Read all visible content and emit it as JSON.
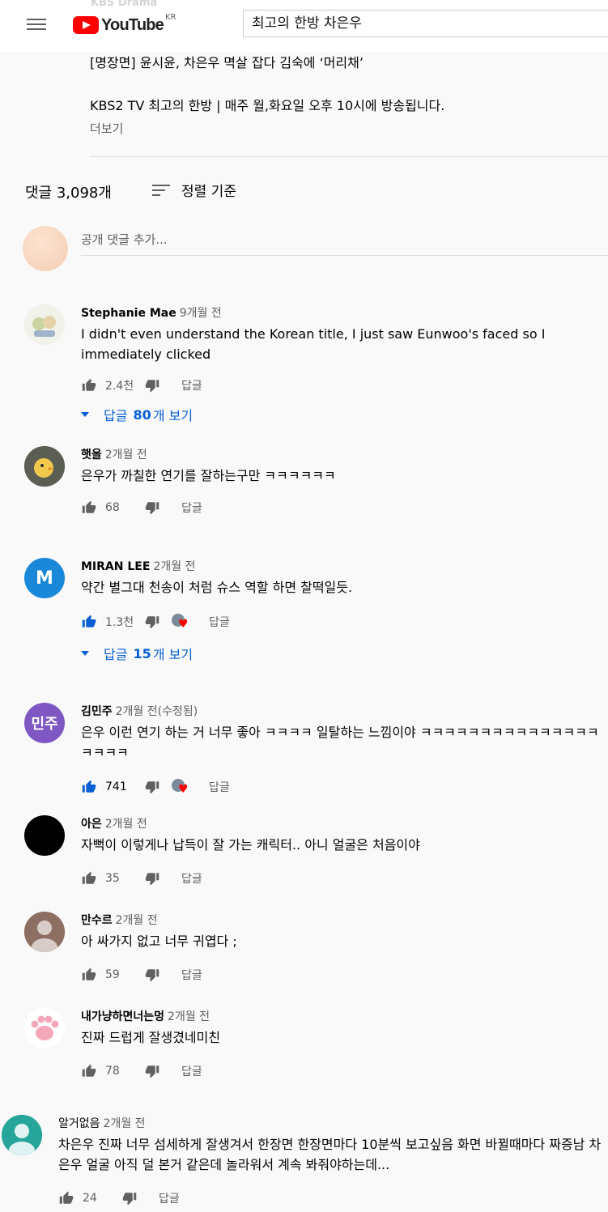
{
  "header": {
    "ghost_channel": "KBS Drama",
    "logo_word": "YouTube",
    "logo_region": "KR",
    "search_value": "최고의 한방 차은우"
  },
  "description": {
    "line1": "[명장면] 윤시윤, 차은우 멱살 잡다 김숙에 ‘머리채’",
    "line2": "KBS2 TV 최고의 한방 | 매주 월,화요일 오후 10시에 방송됩니다.",
    "more": "더보기"
  },
  "comments_header": {
    "count": "댓글 3,098개",
    "sort_label": "정렬 기준"
  },
  "add_comment": {
    "placeholder": "공개 댓글 추가..."
  },
  "comments": [
    {
      "name": "Stephanie Mae",
      "time": "9개월 전",
      "text": "I didn't even understand the Korean title, I just saw Eunwoo's faced so I immediately clicked",
      "likes": "2.4천",
      "reply": "답글",
      "replies_prefix": "답글",
      "replies_count": "80",
      "replies_suffix": "개 보기"
    },
    {
      "name": "햇올",
      "time": "2개월 전",
      "text": "은우가 까칠한 연기를 잘하는구만 ㅋㅋㅋㅋㅋㅋ",
      "likes": "68",
      "reply": "답글"
    },
    {
      "name": "MIRAN LEE",
      "time": "2개월 전",
      "avatar_letter": "M",
      "text": "약간 별그대 천송이 처럼 슈스 역할 하면 찰떡일듯.",
      "likes": "1.3천",
      "reply": "답글",
      "replies_prefix": "답글",
      "replies_count": "15",
      "replies_suffix": "개 보기"
    },
    {
      "name": "김민주",
      "time": "2개월 전(수정됨)",
      "avatar_letter": "민주",
      "text": "은우 이런 연기 하는 거 너무 좋아 ㅋㅋㅋㅋ 일탈하는 느낌이야 ㅋㅋㅋㅋㅋㅋㅋㅋㅋㅋㅋㅋㅋㅋㅋㅋㅋㅋㅋ",
      "likes": "741",
      "reply": "답글"
    },
    {
      "name": "아은",
      "time": "2개월 전",
      "text": "자뻑이 이렇게나 납득이 잘 가는 캐릭터.. 아니 얼굴은 처음이야",
      "likes": "35",
      "reply": "답글"
    },
    {
      "name": "만수르",
      "time": "2개월 전",
      "text": "아 싸가지 없고 너무 귀엽다 ;",
      "likes": "59",
      "reply": "답글"
    },
    {
      "name": "내가냥하면너는멍",
      "time": "2개월 전",
      "text": "진짜 드럽게 잘생겼네미친",
      "likes": "78",
      "reply": "답글"
    },
    {
      "name": "알거없음",
      "time": "2개월 전",
      "text": "차은우 진짜 너무 섬세하게 잘생겨서 한장면 한장면마다 10분씩 보고싶음 화면 바뀔때마다 짜증남 차은우 얼굴 아직 덜 본거 같은데 놀라워서 계속 봐줘야하는데...",
      "likes": "24",
      "reply": "답글"
    }
  ],
  "colors": {
    "accent_blue": "#065fd4",
    "brand_red": "#ff0000",
    "miran_avatar": "#1a88d8",
    "minju_avatar": "#7e57c2"
  }
}
